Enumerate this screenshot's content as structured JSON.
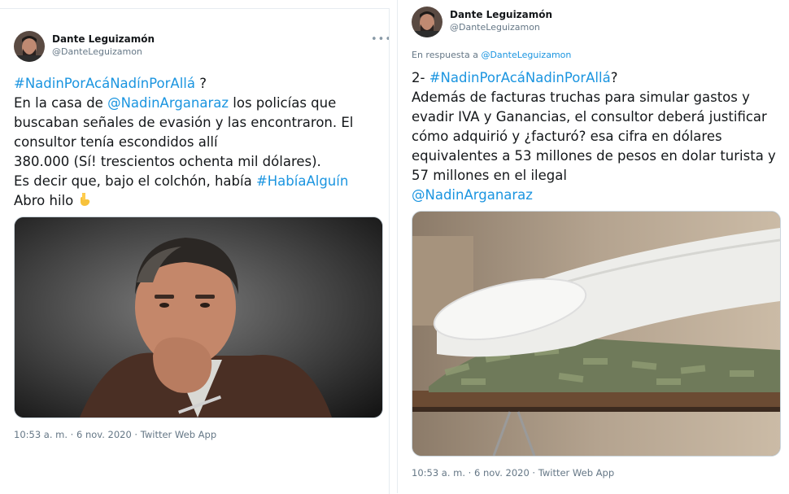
{
  "tweets": [
    {
      "author": {
        "name": "Dante Leguizamón",
        "handle": "@DanteLeguizamon",
        "avatar_icon": "author-avatar"
      },
      "reply_prefix": "",
      "reply_handle": "",
      "text": {
        "l1_tag": "#NadinPorAcáNadínPorAllá",
        "l1_rest": " ?",
        "l2_pre": "En la casa de ",
        "l2_mention": "@NadinArganaraz",
        "l2_post": " los policías que",
        "l3": "buscaban señales de evasión y las encontraron. El",
        "l4": "consultor tenía escondidos allí",
        "l5": "380.000 (Sí! trescientos ochenta mil dólares).",
        "l6_pre": "Es decir que, bajo el colchón, había ",
        "l6_tag": "#HabíaAlguín",
        "l7": "Abro hilo ",
        "emoji_icon": "pointing-down-emoji"
      },
      "media": {
        "icon": "man-portrait-photo"
      },
      "timestamp": "10:53 a. m. · 6 nov. 2020 · Twitter Web App"
    },
    {
      "author": {
        "name": "Dante Leguizamón",
        "handle": "@DanteLeguizamon",
        "avatar_icon": "author-avatar"
      },
      "reply_prefix": "En respuesta a ",
      "reply_handle": "@DanteLeguizamon",
      "text": {
        "l1_pre": "2- ",
        "l1_tag": "#NadinPorAcáNadinPorAllá",
        "l1_rest": "?",
        "l2": "Además de facturas truchas para simular gastos y",
        "l3": "evadir IVA y Ganancias, el consultor deberá justificar",
        "l4": "cómo adquirió y ¿facturó? esa cifra en dólares",
        "l5": "equivalentes a 53 millones de pesos en dolar turista y",
        "l6": "57 millones en el ilegal",
        "l7_mention": "@NadinArganaraz"
      },
      "media": {
        "icon": "money-under-mattress-photo"
      },
      "timestamp": "10:53 a. m. · 6 nov. 2020 · Twitter Web App"
    }
  ],
  "more_label": "•••",
  "colors": {
    "link": "#1b95e0",
    "muted": "#657786",
    "text": "#14171a"
  }
}
